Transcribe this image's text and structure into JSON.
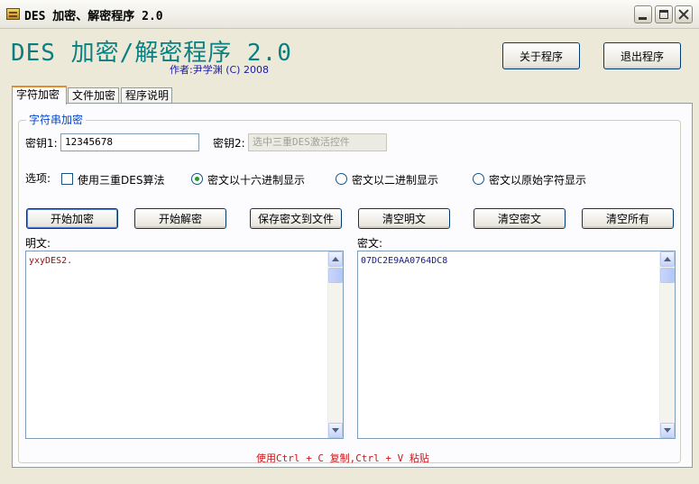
{
  "window": {
    "title": "DES 加密、解密程序 2.0",
    "icon": "app-icon"
  },
  "header": {
    "title": "DES 加密/解密程序 2.0",
    "author": "作者:尹学渊  (C) 2008",
    "about_button": "关于程序",
    "exit_button": "退出程序"
  },
  "tabs": [
    {
      "label": "字符加密",
      "active": true
    },
    {
      "label": "文件加密",
      "active": false
    },
    {
      "label": "程序说明",
      "active": false
    }
  ],
  "group": {
    "title": "字符串加密",
    "key1_label": "密钥1:",
    "key1_value": "12345678",
    "key2_label": "密钥2:",
    "key2_value": "选中三重DES激活控件",
    "options_label": "选项:",
    "triple_des_label": "使用三重DES算法",
    "triple_des_checked": false,
    "radio_hex_label": "密文以十六进制显示",
    "radio_bin_label": "密文以二进制显示",
    "radio_raw_label": "密文以原始字符显示",
    "selected_radio": "hex"
  },
  "buttons": {
    "encrypt": "开始加密",
    "decrypt": "开始解密",
    "save": "保存密文到文件",
    "clear_plain": "清空明文",
    "clear_cipher": "清空密文",
    "clear_all": "清空所有"
  },
  "plaintext": {
    "label": "明文:",
    "value": "yxyDES2."
  },
  "ciphertext": {
    "label": "密文:",
    "value": "07DC2E9AA0764DC8"
  },
  "hint": "使用Ctrl + C 复制,Ctrl + V 粘贴",
  "colors": {
    "title_teal": "#0a7f80",
    "author_blue": "#1a1aa6",
    "plain_text_red": "#8b1010",
    "cipher_text_blue": "#1a1a8c",
    "hint_red": "#c81818",
    "tab_highlight": "#e68b2c"
  }
}
